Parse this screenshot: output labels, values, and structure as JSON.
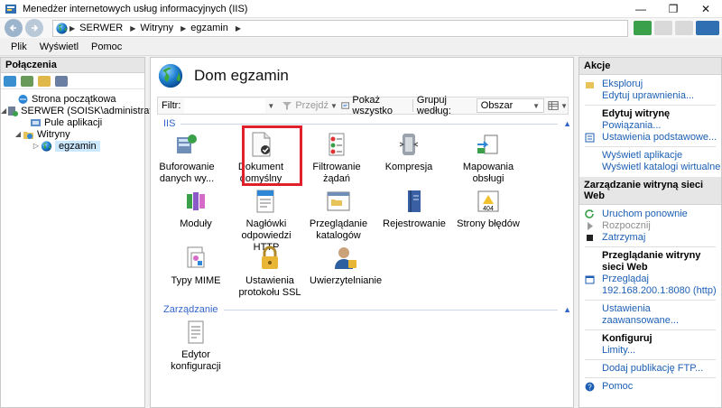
{
  "window": {
    "title": "Menedżer internetowych usług informacyjnych (IIS)",
    "minimize": "—",
    "maximize": "❐",
    "close": "✕"
  },
  "address": {
    "crumbs": [
      "SERWER",
      "Witryny",
      "egzamin"
    ],
    "separator": "▶"
  },
  "menu": [
    "Plik",
    "Wyświetl",
    "Pomoc"
  ],
  "connections": {
    "title": "Połączenia",
    "tree": [
      {
        "label": "Strona początkowa",
        "level": 0,
        "icon": "home-icon"
      },
      {
        "label": "SERWER (SOISK\\administrator)",
        "level": 0,
        "icon": "server-icon",
        "expander": "◢"
      },
      {
        "label": "Pule aplikacji",
        "level": 1,
        "icon": "app-pool-icon"
      },
      {
        "label": "Witryny",
        "level": 1,
        "icon": "sites-folder-icon",
        "expander": "◢"
      },
      {
        "label": "egzamin",
        "level": 2,
        "icon": "globe-icon",
        "expander": "▷",
        "selected": true
      }
    ]
  },
  "center": {
    "title": "Dom egzamin",
    "filter_label": "Filtr:",
    "filter_value": "",
    "go_label": "Przejdź",
    "show_all_label": "Pokaż wszystko",
    "group_label": "Grupuj według:",
    "group_value": "Obszar",
    "sections": [
      {
        "name": "IIS",
        "chevron": "▲"
      },
      {
        "name": "Zarządzanie",
        "chevron": "▲"
      }
    ],
    "features": [
      {
        "label": "Buforowanie danych wy...",
        "icon": "output-caching-icon"
      },
      {
        "label": "Dokument domyślny",
        "icon": "default-document-icon"
      },
      {
        "label": "Filtrowanie żądań",
        "icon": "request-filtering-icon"
      },
      {
        "label": "Kompresja",
        "icon": "compression-icon"
      },
      {
        "label": "Mapowania obsługi",
        "icon": "handler-mappings-icon"
      },
      {
        "label": "Moduły",
        "icon": "modules-icon"
      },
      {
        "label": "Nagłówki odpowiedzi HTTP",
        "icon": "http-headers-icon"
      },
      {
        "label": "Przeglądanie katalogów",
        "icon": "directory-browsing-icon"
      },
      {
        "label": "Rejestrowanie",
        "icon": "logging-icon"
      },
      {
        "label": "Strony błędów",
        "icon": "error-pages-icon"
      },
      {
        "label": "Typy MIME",
        "icon": "mime-types-icon"
      },
      {
        "label": "Ustawienia protokołu SSL",
        "icon": "ssl-settings-icon"
      },
      {
        "label": "Uwierzytelnianie",
        "icon": "authentication-icon"
      }
    ],
    "management_features": [
      {
        "label": "Edytor konfiguracji",
        "icon": "config-editor-icon"
      }
    ],
    "error_badge": "404"
  },
  "actions": {
    "title": "Akcje",
    "items": [
      {
        "type": "link",
        "label": "Eksploruj",
        "icon": "explore-icon"
      },
      {
        "type": "link",
        "label": "Edytuj uprawnienia...",
        "icon": ""
      },
      {
        "type": "sep"
      },
      {
        "type": "bold",
        "label": "Edytuj witrynę"
      },
      {
        "type": "link",
        "label": "Powiązania...",
        "icon": ""
      },
      {
        "type": "link",
        "label": "Ustawienia podstawowe...",
        "icon": "settings-icon"
      },
      {
        "type": "sep"
      },
      {
        "type": "link",
        "label": "Wyświetl aplikacje",
        "icon": ""
      },
      {
        "type": "link",
        "label": "Wyświetl katalogi wirtualne",
        "icon": ""
      }
    ],
    "manage_head": "Zarządzanie witryną sieci Web",
    "manage_items": [
      {
        "type": "link",
        "label": "Uruchom ponownie",
        "icon": "restart-icon"
      },
      {
        "type": "disabled",
        "label": "Rozpocznij",
        "icon": "start-icon"
      },
      {
        "type": "link",
        "label": "Zatrzymaj",
        "icon": "stop-icon"
      },
      {
        "type": "sep"
      },
      {
        "type": "bold",
        "label": "Przeglądanie witryny sieci Web"
      },
      {
        "type": "link",
        "label": "Przeglądaj 192.168.200.1:8080 (http)",
        "icon": "browse-icon"
      },
      {
        "type": "sep"
      },
      {
        "type": "link",
        "label": "Ustawienia zaawansowane...",
        "icon": ""
      },
      {
        "type": "sep"
      },
      {
        "type": "bold",
        "label": "Konfiguruj"
      },
      {
        "type": "link",
        "label": "Limity...",
        "icon": ""
      },
      {
        "type": "sep"
      },
      {
        "type": "link",
        "label": "Dodaj publikację FTP...",
        "icon": ""
      },
      {
        "type": "sep"
      },
      {
        "type": "link",
        "label": "Pomoc",
        "icon": "help-icon"
      }
    ]
  },
  "colors": {
    "link": "#1c5fb5",
    "section": "#3366cc",
    "highlight": "#e0202a",
    "selection": "#cce8ff"
  }
}
